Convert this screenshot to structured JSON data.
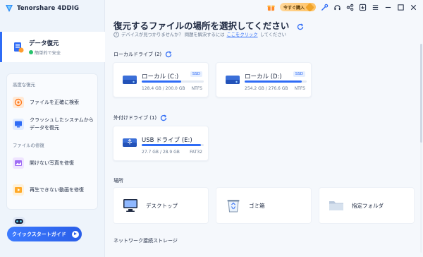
{
  "app": {
    "name": "Tenorshare 4DDIG"
  },
  "titlebar": {
    "buy_label": "今すぐ購入"
  },
  "sidebar": {
    "recover_title": "データ復元",
    "recover_sub": "簡単的で安全",
    "advanced_section": "高度な復元",
    "items_advanced": [
      {
        "label": "ファイルを正確に検索",
        "icon": "target-search-icon"
      },
      {
        "label": "クラッシュしたシステムからデータを復元",
        "icon": "monitor-crash-icon"
      }
    ],
    "repair_section": "ファイルの修復",
    "items_repair": [
      {
        "label": "開けない写真を修復",
        "icon": "photo-repair-icon"
      },
      {
        "label": "再生できない動画を修復",
        "icon": "video-repair-icon"
      }
    ],
    "quickstart_label": "クイックスタートガイド"
  },
  "main": {
    "title": "復元するファイルの場所を選択してください",
    "help_text": "デバイスが見つかりませんか？ 問題を解決するには",
    "help_link": "ここをクリック",
    "help_suffix": "してください",
    "local_drives_title": "ローカルドライブ (2)",
    "local_drives": [
      {
        "name": "ローカル (C:)",
        "badge": "SSD",
        "used": "128.4 GB",
        "total": "200.0 GB",
        "size_text": "128.4 GB / 200.0 GB",
        "fs": "NTFS",
        "usage_fraction": 0.642
      },
      {
        "name": "ローカル (D:)",
        "badge": "SSD",
        "used": "254.2 GB",
        "total": "276.6 GB",
        "size_text": "254.2 GB / 276.6 GB",
        "fs": "NTFS",
        "usage_fraction": 0.919
      }
    ],
    "external_drives_title": "外付けドライブ (1)",
    "external_drives": [
      {
        "name": "USB ドライブ (E:)",
        "size_text": "27.7 GB / 28.9 GB",
        "fs": "FAT32",
        "usage_fraction": 0.958
      }
    ],
    "locations_title": "場所",
    "locations": [
      {
        "label": "デスクトップ",
        "icon": "desktop-icon"
      },
      {
        "label": "ゴミ箱",
        "icon": "recycle-bin-icon"
      },
      {
        "label": "指定フォルダ",
        "icon": "folder-icon"
      }
    ],
    "network_title": "ネットワーク接続ストレージ"
  },
  "colors": {
    "accent": "#2f6cf6",
    "safe": "#27c26c",
    "buy": "#ffc263"
  }
}
